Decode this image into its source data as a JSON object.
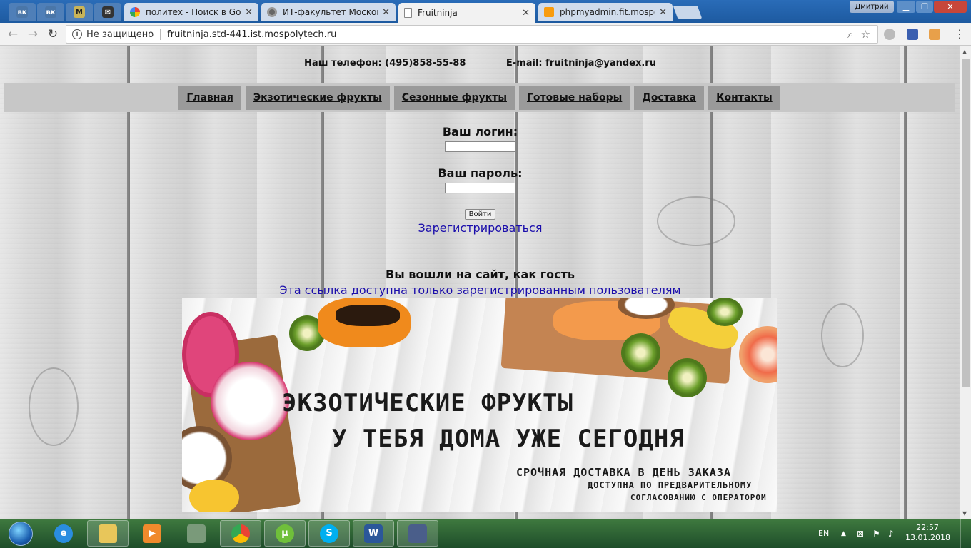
{
  "browser": {
    "tabs": [
      {
        "title": "политех - Поиск в Goog"
      },
      {
        "title": "ИТ-факультет Московс"
      },
      {
        "title": "Fruitninja"
      },
      {
        "title": "phpmyadmin.fit.mospoly"
      }
    ],
    "user_badge": "Дмитрий",
    "security_label": "Не защищено",
    "url": "fruitninja.std-441.ist.mospolytech.ru",
    "colors": {
      "tabstrip": "#1f5fa8",
      "link": "#1a0dab"
    }
  },
  "page": {
    "phone": "Наш телефон: (495)858-55-88",
    "email": "E-mail: fruitninja@yandex.ru",
    "nav": [
      "Главная",
      "Экзотические фрукты",
      "Сезонные фрукты",
      "Готовые наборы",
      "Доставка",
      "Контакты"
    ],
    "login_label": "Ваш логин:",
    "password_label": "Ваш пароль:",
    "login_value": "",
    "password_value": "",
    "submit_label": "Войти",
    "register_link": "Зарегистрироваться",
    "guest_text": "Вы вошли на сайт, как гость",
    "members_link": "Эта ссылка доступна только зарегистрированным пользователям",
    "banner": {
      "line1": "ЭКЗОТИЧЕСКИЕ ФРУКТЫ",
      "line2": "У ТЕБЯ ДОМА УЖЕ СЕГОДНЯ",
      "line3": "СРОЧНАЯ ДОСТАВКА В ДЕНЬ ЗАКАЗА",
      "line4": "ДОСТУПНА ПО ПРЕДВАРИТЕЛЬНОМУ",
      "line5": "СОГЛАСОВАНИЮ С ОПЕРАТОРОМ"
    }
  },
  "taskbar": {
    "lang": "EN",
    "time": "22:57",
    "date": "13.01.2018"
  }
}
